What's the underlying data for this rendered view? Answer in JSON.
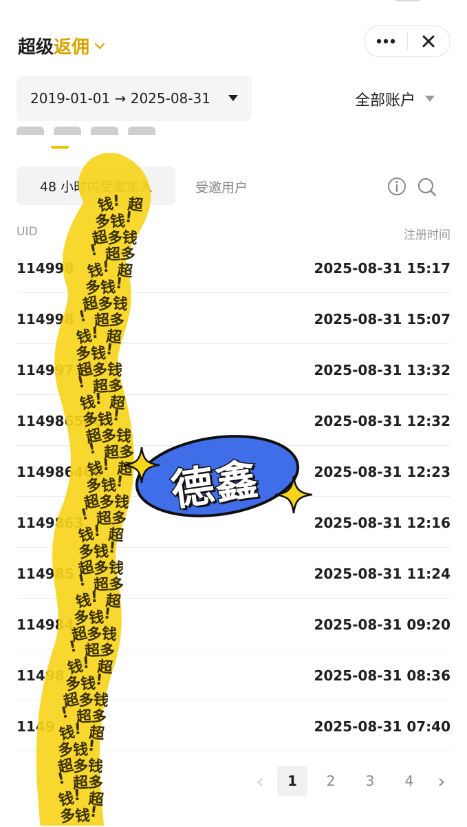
{
  "header": {
    "title_main": "超级",
    "title_accent": "返佣",
    "menu_icon": "more-dots-icon",
    "close_icon": "close-icon"
  },
  "filters": {
    "date_start": "2019-01-01",
    "date_end": "2025-08-31",
    "date_arrow": "→",
    "account_label": "全部账户"
  },
  "segments": {
    "active": "48 小时内受邀加入",
    "other": "受邀用户"
  },
  "table": {
    "col_uid": "UID",
    "col_time": "注册时间",
    "rows": [
      {
        "uid": "114998",
        "time": "2025-08-31 15:17"
      },
      {
        "uid": "114998",
        "time": "2025-08-31 15:07"
      },
      {
        "uid": "11499716",
        "time": "2025-08-31 13:32"
      },
      {
        "uid": "114986546",
        "time": "2025-08-31 12:32"
      },
      {
        "uid": "114986460",
        "time": "2025-08-31 12:23"
      },
      {
        "uid": "1149863",
        "time": "2025-08-31 12:16"
      },
      {
        "uid": "114985",
        "time": "2025-08-31 11:24"
      },
      {
        "uid": "114984",
        "time": "2025-08-31 09:20"
      },
      {
        "uid": "11498",
        "time": "2025-08-31 08:36"
      },
      {
        "uid": "1149",
        "time": "2025-08-31 07:40"
      }
    ]
  },
  "pagination": {
    "prev": "‹",
    "pages": [
      "1",
      "2",
      "3",
      "4"
    ],
    "current": "1",
    "next": "›"
  },
  "overlay": {
    "badge_text": "德鑫",
    "watermark_text": "钱!超多"
  },
  "colors": {
    "accent": "#d7a400",
    "highlight_yellow": "#f7d51c",
    "badge_blue": "#3f6ee8"
  }
}
